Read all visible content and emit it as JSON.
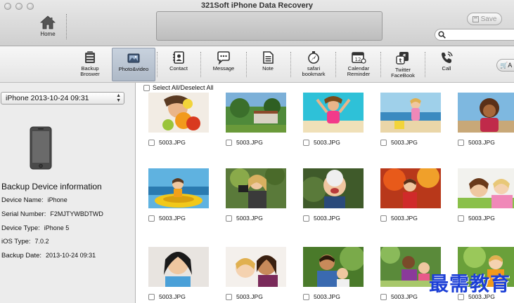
{
  "window": {
    "title": "321Soft iPhone Data Recovery"
  },
  "header": {
    "home_label": "Home",
    "save_label": "Save",
    "search_placeholder": ""
  },
  "toolbar": {
    "items": [
      {
        "label": "Backup\nBroswer",
        "icon": "backup-browser-icon"
      },
      {
        "label": "Photo&video",
        "icon": "photo-video-icon",
        "active": true
      },
      {
        "label": "Contact",
        "icon": "contact-icon"
      },
      {
        "label": "Message",
        "icon": "message-icon"
      },
      {
        "label": "Note",
        "icon": "note-icon"
      },
      {
        "label": "safari\nbookmark",
        "icon": "safari-bookmark-icon"
      },
      {
        "label": "Calendar\nReminder",
        "icon": "calendar-icon"
      },
      {
        "label": "Twitter\nFaceBook",
        "icon": "twitter-facebook-icon"
      },
      {
        "label": "Call",
        "icon": "call-icon"
      }
    ],
    "cart_label": "A"
  },
  "select_all_label": "Select All/Deselect All",
  "sidebar": {
    "device_select_value": "iPhone 2013-10-24 09:31",
    "info_title": "Backup Device information",
    "info": [
      {
        "key": "Device Name:",
        "value": "iPhone"
      },
      {
        "key": "Serial Number:",
        "value": "F2MJTYWBDTWD"
      },
      {
        "key": "Device Type:",
        "value": "iPhone 5"
      },
      {
        "key": "iOS Type:",
        "value": "7.0.2"
      },
      {
        "key": "Backup Date:",
        "value": "2013-10-24 09:31"
      }
    ]
  },
  "photos": [
    {
      "name": "5003.JPG"
    },
    {
      "name": "5003.JPG"
    },
    {
      "name": "5003.JPG"
    },
    {
      "name": "5003.JPG"
    },
    {
      "name": "5003.JPG"
    },
    {
      "name": "5003.JPG"
    },
    {
      "name": "5003.JPG"
    },
    {
      "name": "5003.JPG"
    },
    {
      "name": "5003.JPG"
    },
    {
      "name": "5003.JPG"
    },
    {
      "name": "5003.JPG"
    },
    {
      "name": "5003.JPG"
    },
    {
      "name": "5003.JPG"
    },
    {
      "name": "5003.JPG"
    },
    {
      "name": "5003.JPG"
    }
  ],
  "watermark": "最需教育"
}
